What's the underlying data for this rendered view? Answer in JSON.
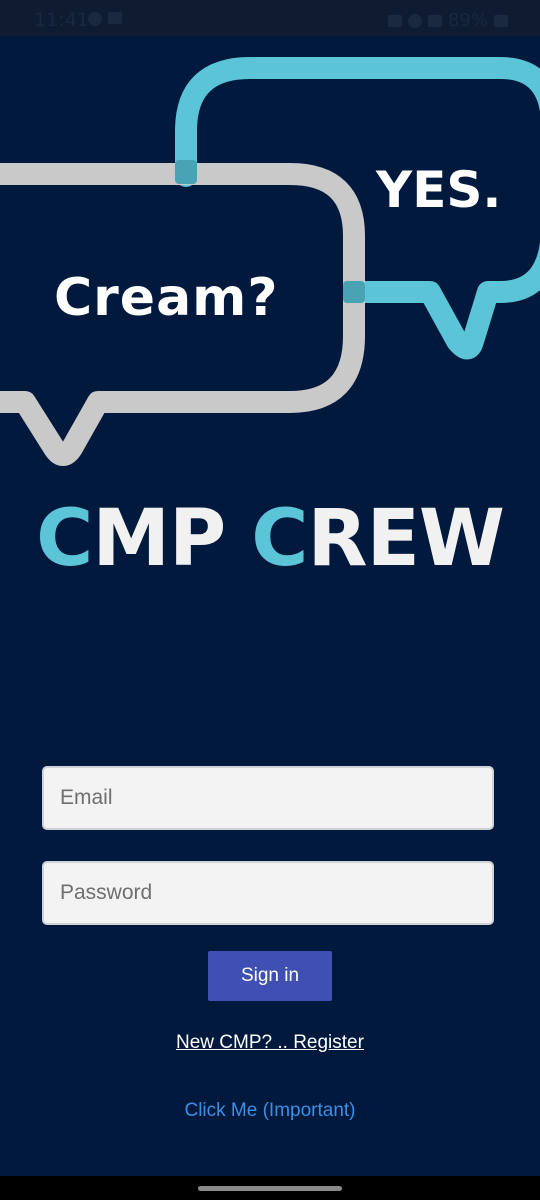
{
  "status_bar": {
    "time": "11:41",
    "battery": "89%",
    "icons_left": [
      "whatsapp-icon",
      "image-icon"
    ],
    "icons_right": [
      "mute-icon",
      "wifi-icon",
      "signal-icon",
      "battery-icon"
    ]
  },
  "hero": {
    "question_text": "Cream?",
    "answer_text": "YES.",
    "colors": {
      "bubble_gray": "#c9c9c9",
      "bubble_cyan": "#5bc4d6"
    }
  },
  "logo": {
    "part1_initial": "C",
    "part1_rest": "MP",
    "part2_initial": "C",
    "part2_rest": "REW",
    "colors": {
      "accent": "#5bc4d6",
      "text": "#f1f1f1"
    }
  },
  "form": {
    "email_placeholder": "Email",
    "password_placeholder": "Password",
    "signin_label": "Sign in"
  },
  "links": {
    "register_label": "New CMP? .. Register",
    "important_label": "Click Me (Important)"
  },
  "theme": {
    "background": "#00193c",
    "button": "#3f4fb3",
    "link": "#3c8ee6"
  }
}
